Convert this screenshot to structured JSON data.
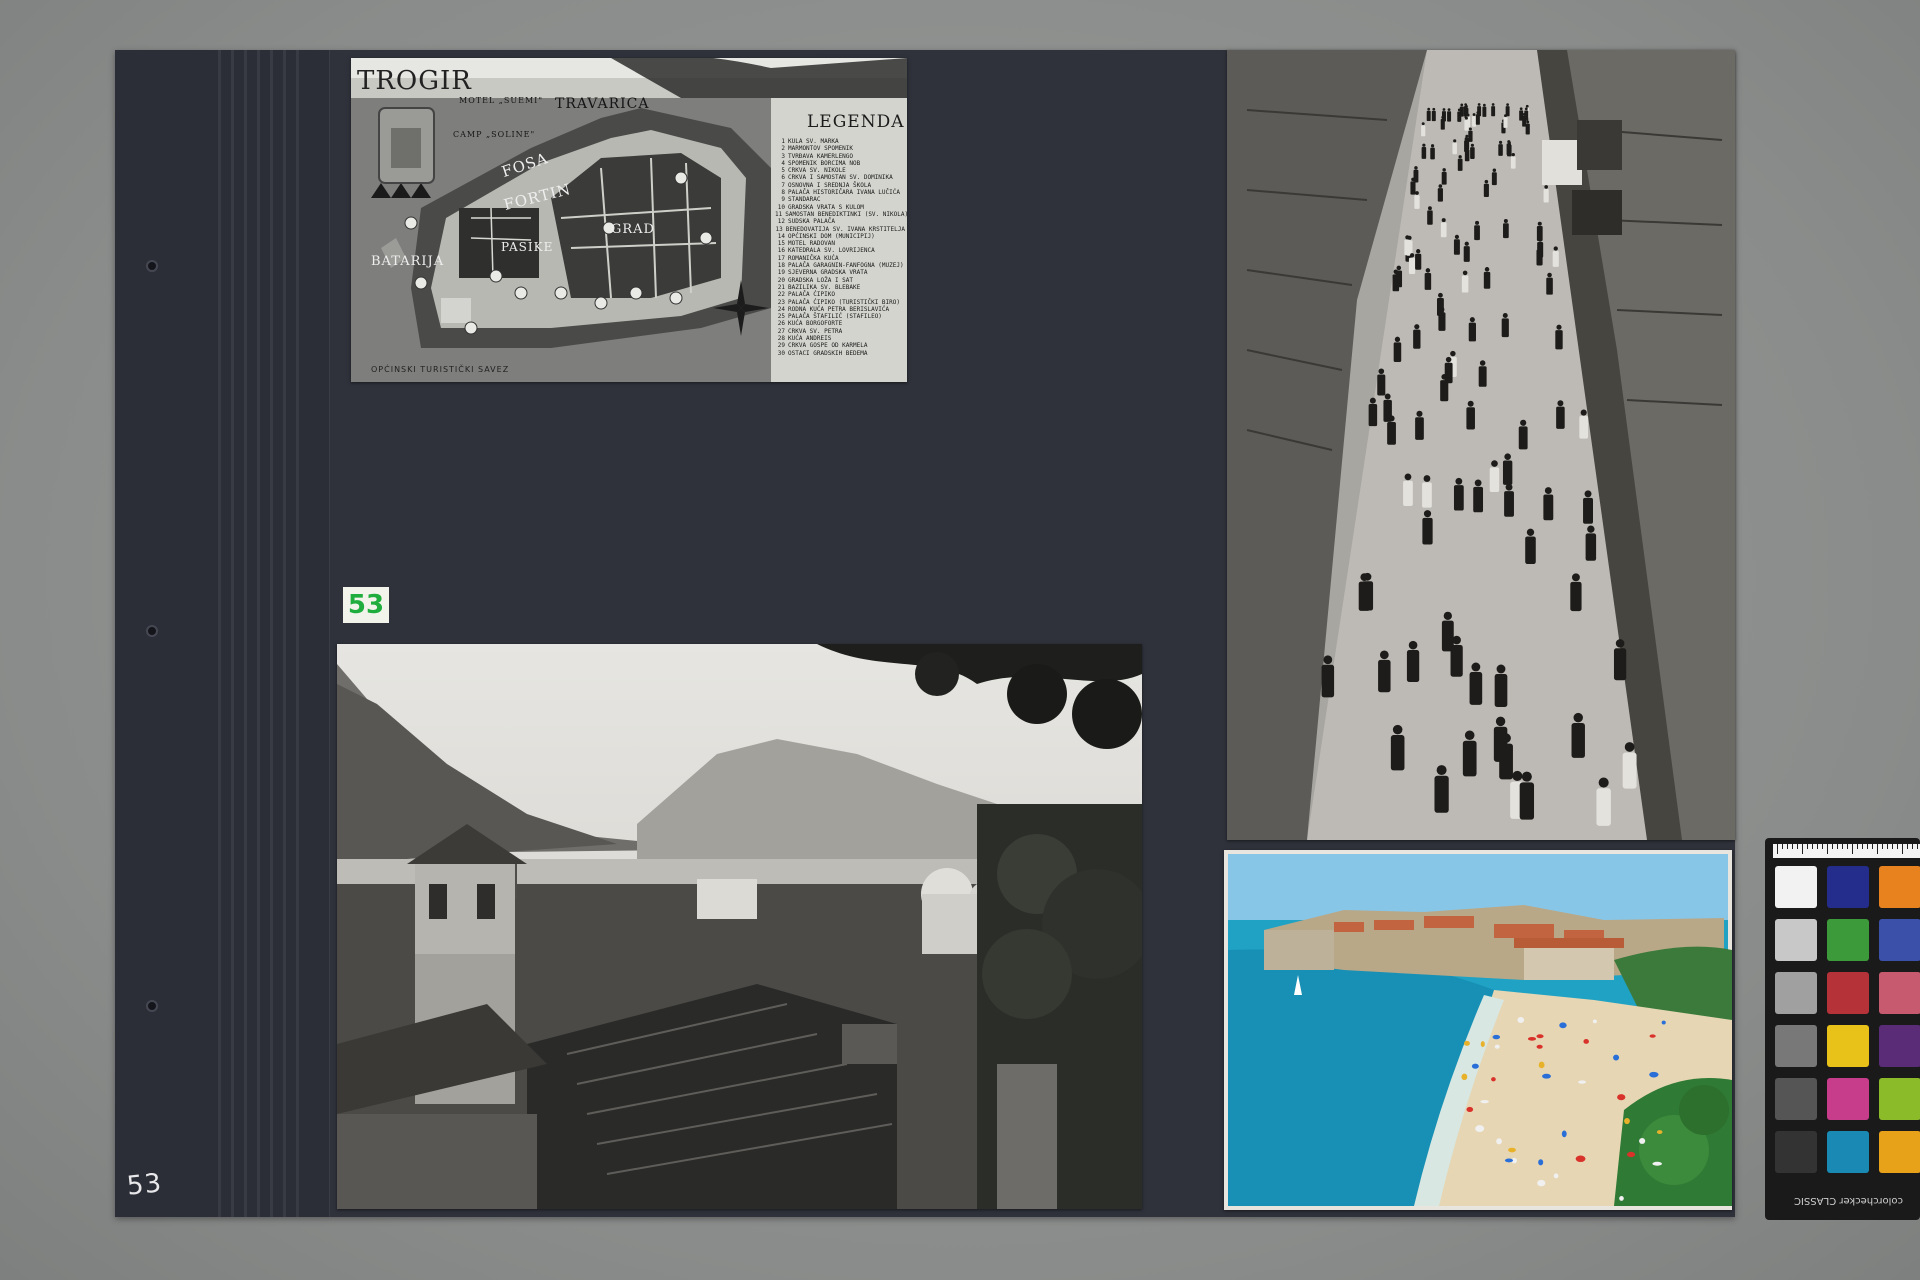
{
  "page": {
    "number": "53"
  },
  "sticker": {
    "text": "53"
  },
  "trogir_map": {
    "title": "TROGIR",
    "legend_title": "LEGENDA",
    "labels": {
      "travarica": "TRAVARICA",
      "motel": "MOTEL „SUEMI\"",
      "camp": "CAMP „SOLINE\"",
      "fosa": "FOSA",
      "fortin": "FORTIN",
      "grad": "GRAD",
      "pasike": "PASIKE",
      "batarija": "BATARIJA"
    },
    "footer": "OPĆINSKI TURISTIČKI SAVEZ",
    "legend": [
      {
        "num": "1",
        "text": "KULA SV. MARKA"
      },
      {
        "num": "2",
        "text": "MARMONTOV SPOMENIK"
      },
      {
        "num": "3",
        "text": "TVRĐAVA KAMERLENGO"
      },
      {
        "num": "4",
        "text": "SPOMENIK BORCIMA NOB"
      },
      {
        "num": "5",
        "text": "CRKVA SV. NIKOLE"
      },
      {
        "num": "6",
        "text": "CRKVA I SAMOSTAN SV. DOMINIKA"
      },
      {
        "num": "7",
        "text": "OSNOVNA I SREDNJA ŠKOLA"
      },
      {
        "num": "8",
        "text": "PALAČA HISTORIČARA IVANA LUČIĆA"
      },
      {
        "num": "9",
        "text": "STANDARAC"
      },
      {
        "num": "10",
        "text": "GRADSKA VRATA S KULOM"
      },
      {
        "num": "11",
        "text": "SAMOSTAN BENEDIKTINKI (SV. NIKOLA)"
      },
      {
        "num": "12",
        "text": "SUDSKA PALAČA"
      },
      {
        "num": "13",
        "text": "BENEDOVATIJA SV. IVANA KRSTITELJA"
      },
      {
        "num": "14",
        "text": "OPĆINSKI DOM (MUNICIPIJ)"
      },
      {
        "num": "15",
        "text": "MOTEL RADOVAN"
      },
      {
        "num": "16",
        "text": "KATEDRALA SV. LOVRIJENCA"
      },
      {
        "num": "17",
        "text": "ROMANIČKA KUĆA"
      },
      {
        "num": "18",
        "text": "PALAČA GARAGNIN-FANFOGNA (MUZEJ)"
      },
      {
        "num": "19",
        "text": "SJEVERNA GRADSKA VRATA"
      },
      {
        "num": "20",
        "text": "GRADSKA LOŽA I SAT"
      },
      {
        "num": "21",
        "text": "BAZILIKA SV. BLEBAKE"
      },
      {
        "num": "22",
        "text": "PALAČA ĆIPIKO"
      },
      {
        "num": "23",
        "text": "PALAČA ĆIPIKO (TURISTIČKI BIRO)"
      },
      {
        "num": "24",
        "text": "RODNA KUĆA PETRA BERISLAVIĆA"
      },
      {
        "num": "25",
        "text": "PALAČA ŠTAFILIĆ (STAFILEO)"
      },
      {
        "num": "26",
        "text": "KUĆA BORGOFORTE"
      },
      {
        "num": "27",
        "text": "CRKVA SV. PETRA"
      },
      {
        "num": "28",
        "text": "KUĆA ANDREIS"
      },
      {
        "num": "29",
        "text": "CRKVA GOSPE OD KARMELA"
      },
      {
        "num": "30",
        "text": "OSTACI GRADSKIH BEDEMA"
      }
    ]
  },
  "checker": {
    "label": "colorchecker CLASSIC"
  },
  "colors": {
    "page": "#2f313b",
    "sea": "#1fa2c4",
    "sand": "#e6d6b4",
    "sticker_text": "#1fae3d"
  }
}
